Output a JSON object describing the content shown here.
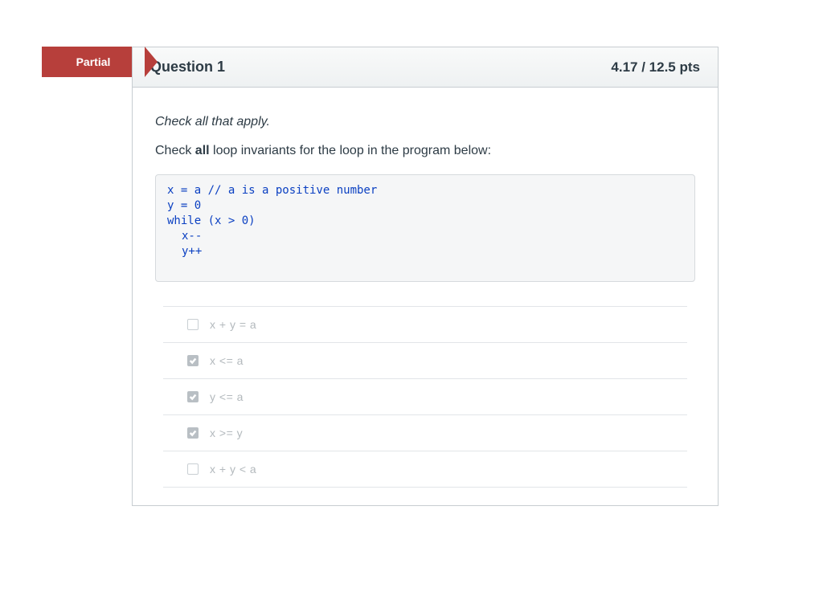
{
  "badge": {
    "label": "Partial"
  },
  "header": {
    "title": "Question 1",
    "points_earned": "4.17",
    "points_possible": "12.5",
    "points_suffix": "pts"
  },
  "body": {
    "instructions": "Check all that apply.",
    "prompt_pre": "Check ",
    "prompt_bold": "all",
    "prompt_post": " loop invariants for the loop in the program below:",
    "code": {
      "lines": [
        {
          "text": "x = a // a is a positive number",
          "indent": false
        },
        {
          "text": "y = 0",
          "indent": false
        },
        {
          "text": "while (x > 0)",
          "indent": false
        },
        {
          "text": "x--",
          "indent": true
        },
        {
          "text": "y++",
          "indent": true
        }
      ]
    }
  },
  "answers": [
    {
      "label": "x + y = a",
      "checked": false
    },
    {
      "label": "x <= a",
      "checked": true
    },
    {
      "label": "y <= a",
      "checked": true
    },
    {
      "label": "x >= y",
      "checked": true
    },
    {
      "label": "x + y < a",
      "checked": false
    }
  ]
}
